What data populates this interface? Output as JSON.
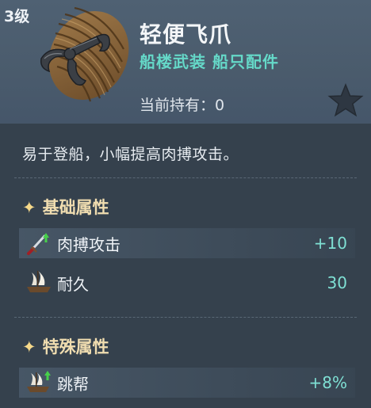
{
  "item": {
    "level": "3级",
    "name": "轻便飞爪",
    "tags": [
      "船楼武装",
      "船只配件"
    ],
    "owned_label": "当前持有：0",
    "icon": "grappling-hook-icon",
    "favorite_icon": "star-icon"
  },
  "description": "易于登船，小幅提高肉搏攻击。",
  "sections": [
    {
      "title": "基础属性",
      "stats": [
        {
          "name": "肉搏攻击",
          "value": "+10",
          "icon": "sword-up-icon"
        },
        {
          "name": "耐久",
          "value": "30",
          "icon": "ship-icon"
        }
      ]
    },
    {
      "title": "特殊属性",
      "stats": [
        {
          "name": "跳帮",
          "value": "+8%",
          "icon": "ship-up-icon"
        }
      ]
    }
  ],
  "colors": {
    "accent": "#65d8c8",
    "section": "#f0ddb0",
    "value": "#7fe0d4"
  }
}
